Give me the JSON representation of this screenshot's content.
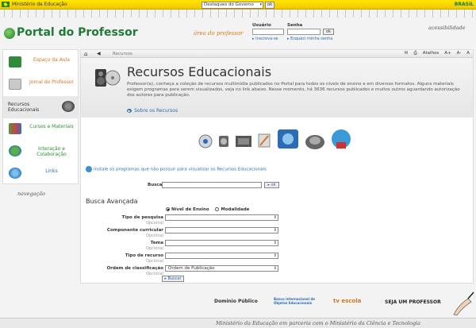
{
  "gov_bar": {
    "ministry": "Ministério da Educação",
    "select_value": "Destaques do Governo",
    "ok_label": "ok",
    "brand": "BRASIL"
  },
  "header": {
    "logo_text": "Portal do Professor",
    "area_label": "área do professor",
    "usuario_label": "Usuário",
    "senha_label": "Senha",
    "ok_label": "ok",
    "register_link": "Inscreva-se",
    "forgot_link": "Esqueci minha senha",
    "accessibility": "acessibilidade"
  },
  "sidebar": {
    "items": [
      {
        "label": "Espaço da Aula",
        "icon": "chalkboard-icon"
      },
      {
        "label": "Jornal do Professor",
        "icon": "newspaper-icon"
      },
      {
        "label": "Recursos Educacionais",
        "icon": "media-icon"
      },
      {
        "label": "Cursos e Materiais",
        "icon": "books-icon"
      },
      {
        "label": "Interação e Colaboração",
        "icon": "people-icon"
      },
      {
        "label": "Links",
        "icon": "globe-icon"
      }
    ],
    "navegacao": "navegação"
  },
  "toolbar": {
    "breadcrumb": "Recursos",
    "atalhos": "Atalhos",
    "font_increase": "A+",
    "font_decrease": "A-",
    "font_normal": "A"
  },
  "banner": {
    "title": "Recursos Educacionais",
    "description": "Professor(a), conheça a coleção de recursos multimídia publicados no Portal para todos os níveis de ensino e em diversos formatos. Alguns materiais exigem programas para serem visualizados, veja no link abaixo. Nesse momento, há 3636 recursos publicados e muitos outros aguardando autorização dos autores para publicação.",
    "about_link": "Sobre os Recursos"
  },
  "install_link": "Instale os programas que não possuir para visualizar os Recursos Educacionais",
  "search": {
    "label": "Busca",
    "value": "",
    "ok_label": "ok"
  },
  "advanced": {
    "title": "Busca Avançada",
    "radio_nivel": "Nível de Ensino",
    "radio_modalidade": "Modalidade",
    "fields": [
      {
        "label": "Tipo de pesquisa",
        "optional": "Opcional",
        "value": ""
      },
      {
        "label": "Componente curricular",
        "optional": "Opcional",
        "value": ""
      },
      {
        "label": "Tema",
        "optional": "Opcional",
        "value": ""
      },
      {
        "label": "Tipo de recurso",
        "optional": "Opcional",
        "value": ""
      },
      {
        "label": "Ordem de classificação",
        "optional": "Opcional",
        "value": "Ordem de Publicação"
      }
    ],
    "buscar_label": "Buscar"
  },
  "footer": {
    "partner_dominio": "Domínio Público",
    "partner_banco": "Banco Internacional de Objetos Educacionais",
    "partner_tv": "tv escola",
    "partner_seja": "SEJA UM PROFESSOR",
    "tagline": "Ministério da Educação em parceria com o Ministério da Ciência e Tecnologia"
  },
  "colors": {
    "accent_green": "#1f7a36",
    "accent_orange": "#d2761c",
    "link_blue": "#2a6db5",
    "gov_yellow": "#ffe600"
  }
}
